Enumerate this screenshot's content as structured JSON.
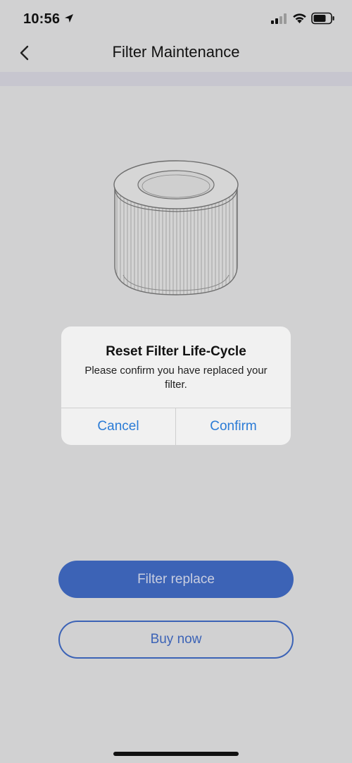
{
  "status_bar": {
    "time": "10:56",
    "icons": [
      "location-arrow-icon",
      "cellular-signal-icon",
      "wifi-icon",
      "battery-icon"
    ]
  },
  "nav": {
    "title": "Filter Maintenance",
    "back_icon": "chevron-left-icon"
  },
  "product": {
    "image": "filter-cartridge-illustration"
  },
  "dialog": {
    "title": "Reset Filter Life-Cycle",
    "message": "Please confirm you have replaced your filter.",
    "cancel_label": "Cancel",
    "confirm_label": "Confirm"
  },
  "actions": {
    "primary_label": "Filter replace",
    "secondary_label": "Buy now"
  },
  "colors": {
    "accent": "#3c63b6",
    "dialog_button": "#2a7bd6",
    "overlay_background": "#d1d1d2"
  }
}
